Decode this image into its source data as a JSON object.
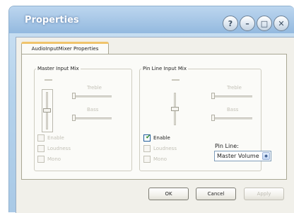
{
  "window": {
    "title": "Properties"
  },
  "titlebar_buttons": {
    "help": "?",
    "minimize": "–",
    "maximize": "□",
    "close": "✕"
  },
  "tab": {
    "label": "AudioInputMixer Properties"
  },
  "master_group": {
    "legend": "Master Input Mix",
    "treble_label": "Treble",
    "bass_label": "Bass",
    "enable_label": "Enable",
    "loudness_label": "Loudness",
    "mono_label": "Mono",
    "enable_checked": false
  },
  "pin_group": {
    "legend": "Pin Line Input Mix",
    "treble_label": "Treble",
    "bass_label": "Bass",
    "enable_label": "Enable",
    "loudness_label": "Loudness",
    "mono_label": "Mono",
    "enable_checked": true,
    "pin_line_label": "Pin Line:",
    "pin_line_value": "Master Volume"
  },
  "buttons": {
    "ok": "OK",
    "cancel": "Cancel",
    "apply": "Apply"
  }
}
